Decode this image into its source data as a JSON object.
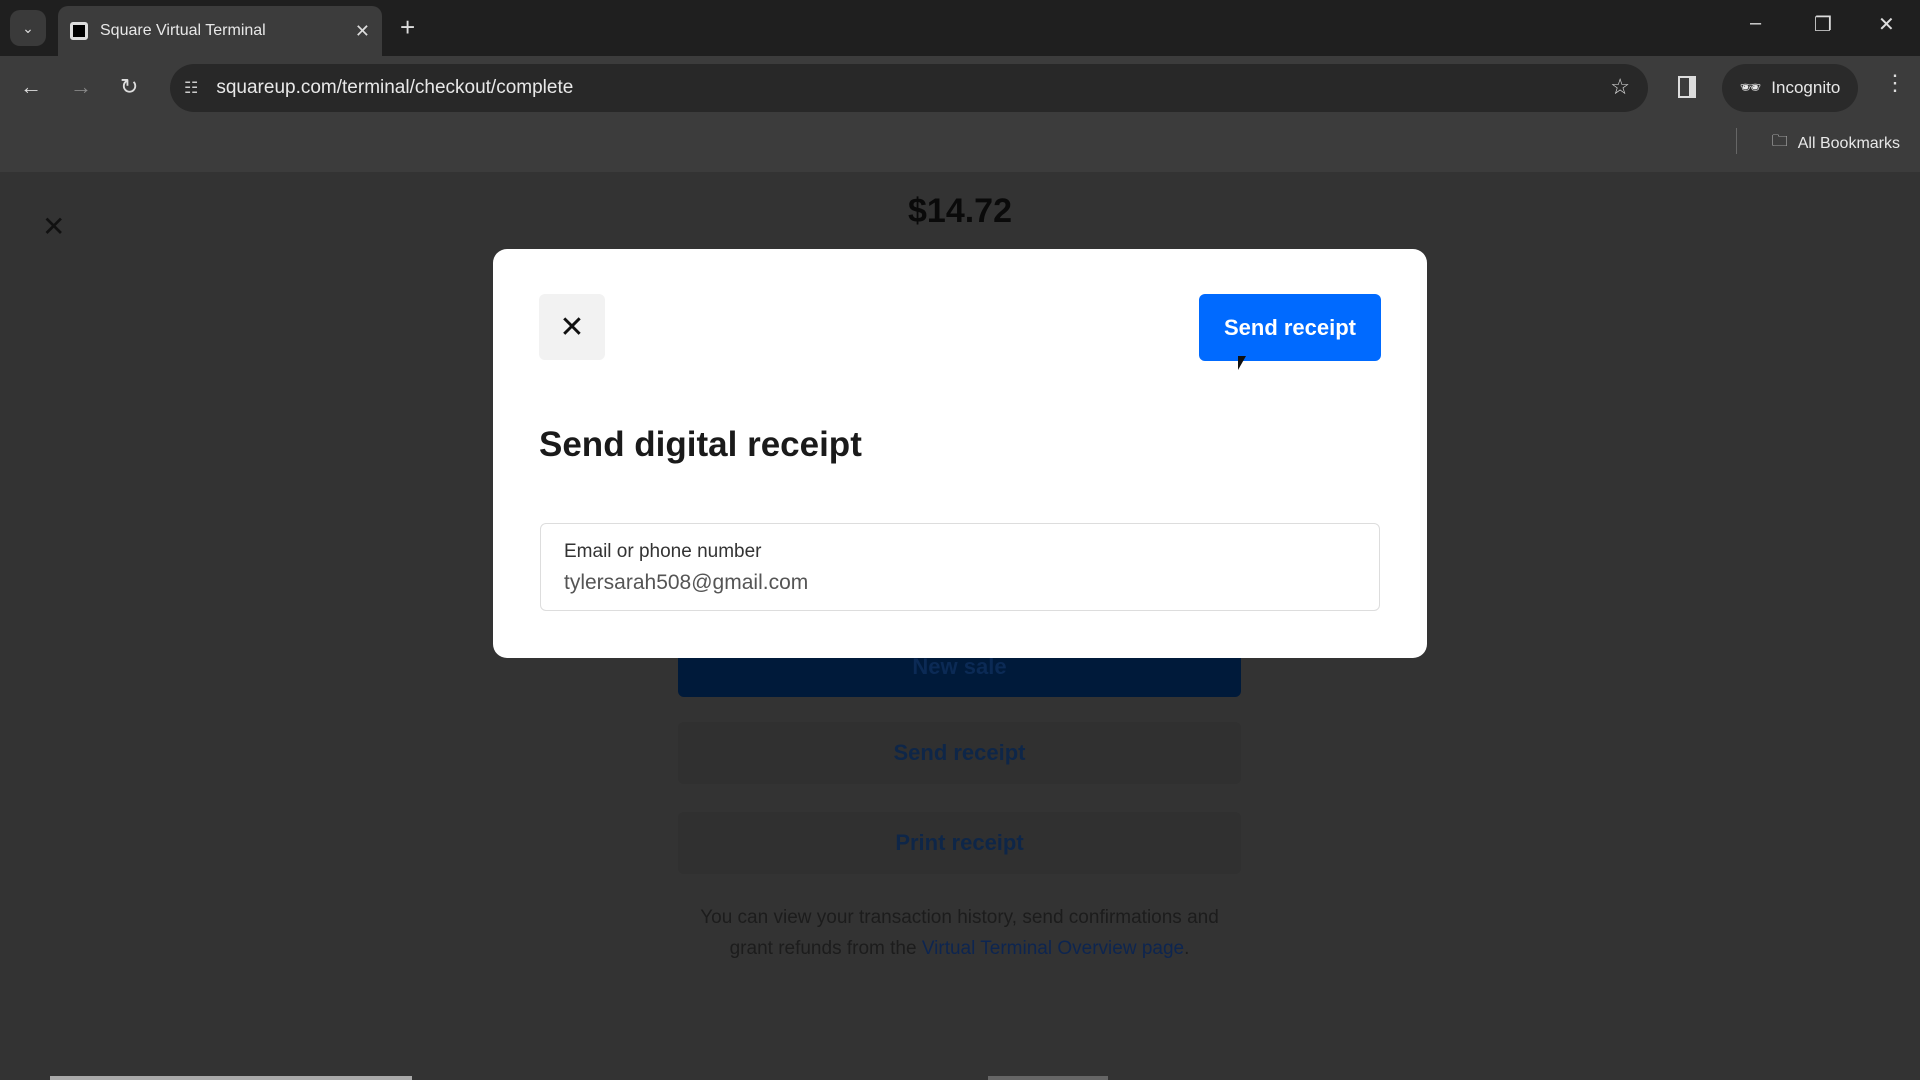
{
  "browser": {
    "tab_title": "Square Virtual Terminal",
    "url": "squareup.com/terminal/checkout/complete",
    "incognito_label": "Incognito",
    "bookmarks_label": "All Bookmarks"
  },
  "page": {
    "amount": "$14.72",
    "new_sale": "New sale",
    "send_receipt": "Send receipt",
    "print_receipt": "Print receipt",
    "footer_text": "You can view your transaction history, send confirmations and grant refunds from the ",
    "footer_link": "Virtual Terminal Overview page",
    "footer_end": "."
  },
  "modal": {
    "title": "Send digital receipt",
    "send_button": "Send receipt",
    "field_label": "Email or phone number",
    "field_value": "tylersarah508@gmail.com"
  },
  "colors": {
    "primary": "#006aff"
  }
}
